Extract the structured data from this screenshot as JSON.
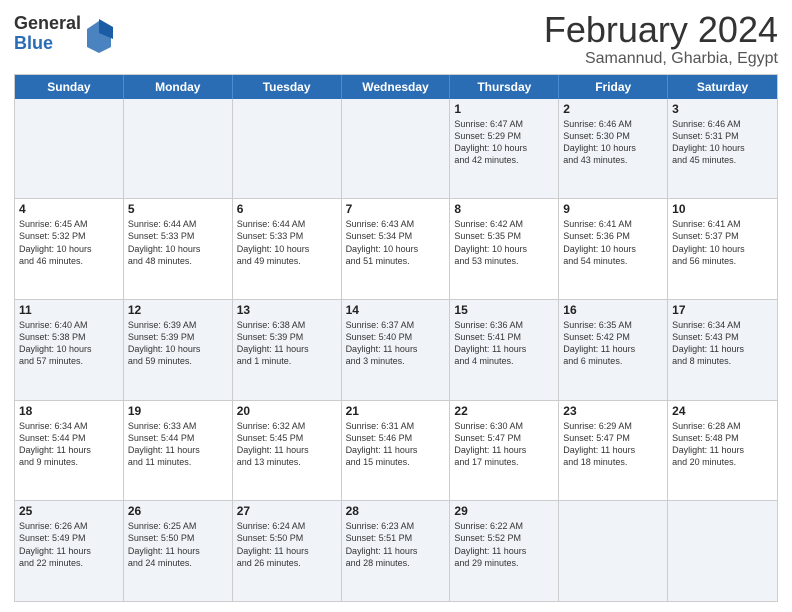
{
  "logo": {
    "general": "General",
    "blue": "Blue"
  },
  "title": {
    "month": "February 2024",
    "location": "Samannud, Gharbia, Egypt"
  },
  "weekdays": [
    "Sunday",
    "Monday",
    "Tuesday",
    "Wednesday",
    "Thursday",
    "Friday",
    "Saturday"
  ],
  "rows": [
    [
      {
        "day": "",
        "info": ""
      },
      {
        "day": "",
        "info": ""
      },
      {
        "day": "",
        "info": ""
      },
      {
        "day": "",
        "info": ""
      },
      {
        "day": "1",
        "info": "Sunrise: 6:47 AM\nSunset: 5:29 PM\nDaylight: 10 hours\nand 42 minutes."
      },
      {
        "day": "2",
        "info": "Sunrise: 6:46 AM\nSunset: 5:30 PM\nDaylight: 10 hours\nand 43 minutes."
      },
      {
        "day": "3",
        "info": "Sunrise: 6:46 AM\nSunset: 5:31 PM\nDaylight: 10 hours\nand 45 minutes."
      }
    ],
    [
      {
        "day": "4",
        "info": "Sunrise: 6:45 AM\nSunset: 5:32 PM\nDaylight: 10 hours\nand 46 minutes."
      },
      {
        "day": "5",
        "info": "Sunrise: 6:44 AM\nSunset: 5:33 PM\nDaylight: 10 hours\nand 48 minutes."
      },
      {
        "day": "6",
        "info": "Sunrise: 6:44 AM\nSunset: 5:33 PM\nDaylight: 10 hours\nand 49 minutes."
      },
      {
        "day": "7",
        "info": "Sunrise: 6:43 AM\nSunset: 5:34 PM\nDaylight: 10 hours\nand 51 minutes."
      },
      {
        "day": "8",
        "info": "Sunrise: 6:42 AM\nSunset: 5:35 PM\nDaylight: 10 hours\nand 53 minutes."
      },
      {
        "day": "9",
        "info": "Sunrise: 6:41 AM\nSunset: 5:36 PM\nDaylight: 10 hours\nand 54 minutes."
      },
      {
        "day": "10",
        "info": "Sunrise: 6:41 AM\nSunset: 5:37 PM\nDaylight: 10 hours\nand 56 minutes."
      }
    ],
    [
      {
        "day": "11",
        "info": "Sunrise: 6:40 AM\nSunset: 5:38 PM\nDaylight: 10 hours\nand 57 minutes."
      },
      {
        "day": "12",
        "info": "Sunrise: 6:39 AM\nSunset: 5:39 PM\nDaylight: 10 hours\nand 59 minutes."
      },
      {
        "day": "13",
        "info": "Sunrise: 6:38 AM\nSunset: 5:39 PM\nDaylight: 11 hours\nand 1 minute."
      },
      {
        "day": "14",
        "info": "Sunrise: 6:37 AM\nSunset: 5:40 PM\nDaylight: 11 hours\nand 3 minutes."
      },
      {
        "day": "15",
        "info": "Sunrise: 6:36 AM\nSunset: 5:41 PM\nDaylight: 11 hours\nand 4 minutes."
      },
      {
        "day": "16",
        "info": "Sunrise: 6:35 AM\nSunset: 5:42 PM\nDaylight: 11 hours\nand 6 minutes."
      },
      {
        "day": "17",
        "info": "Sunrise: 6:34 AM\nSunset: 5:43 PM\nDaylight: 11 hours\nand 8 minutes."
      }
    ],
    [
      {
        "day": "18",
        "info": "Sunrise: 6:34 AM\nSunset: 5:44 PM\nDaylight: 11 hours\nand 9 minutes."
      },
      {
        "day": "19",
        "info": "Sunrise: 6:33 AM\nSunset: 5:44 PM\nDaylight: 11 hours\nand 11 minutes."
      },
      {
        "day": "20",
        "info": "Sunrise: 6:32 AM\nSunset: 5:45 PM\nDaylight: 11 hours\nand 13 minutes."
      },
      {
        "day": "21",
        "info": "Sunrise: 6:31 AM\nSunset: 5:46 PM\nDaylight: 11 hours\nand 15 minutes."
      },
      {
        "day": "22",
        "info": "Sunrise: 6:30 AM\nSunset: 5:47 PM\nDaylight: 11 hours\nand 17 minutes."
      },
      {
        "day": "23",
        "info": "Sunrise: 6:29 AM\nSunset: 5:47 PM\nDaylight: 11 hours\nand 18 minutes."
      },
      {
        "day": "24",
        "info": "Sunrise: 6:28 AM\nSunset: 5:48 PM\nDaylight: 11 hours\nand 20 minutes."
      }
    ],
    [
      {
        "day": "25",
        "info": "Sunrise: 6:26 AM\nSunset: 5:49 PM\nDaylight: 11 hours\nand 22 minutes."
      },
      {
        "day": "26",
        "info": "Sunrise: 6:25 AM\nSunset: 5:50 PM\nDaylight: 11 hours\nand 24 minutes."
      },
      {
        "day": "27",
        "info": "Sunrise: 6:24 AM\nSunset: 5:50 PM\nDaylight: 11 hours\nand 26 minutes."
      },
      {
        "day": "28",
        "info": "Sunrise: 6:23 AM\nSunset: 5:51 PM\nDaylight: 11 hours\nand 28 minutes."
      },
      {
        "day": "29",
        "info": "Sunrise: 6:22 AM\nSunset: 5:52 PM\nDaylight: 11 hours\nand 29 minutes."
      },
      {
        "day": "",
        "info": ""
      },
      {
        "day": "",
        "info": ""
      }
    ]
  ],
  "alt_rows": [
    0,
    2,
    4
  ]
}
